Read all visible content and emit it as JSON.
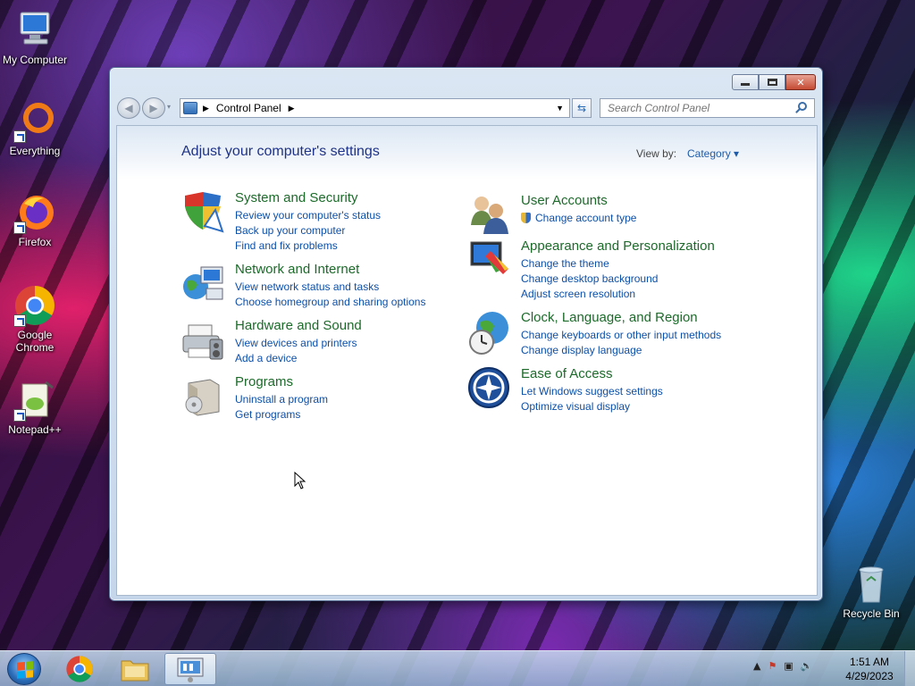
{
  "desktop": {
    "icons": [
      {
        "label": "My Computer"
      },
      {
        "label": "Everything"
      },
      {
        "label": "Firefox"
      },
      {
        "label": "Google Chrome"
      },
      {
        "label": "Notepad++"
      }
    ],
    "recycle_bin": "Recycle Bin"
  },
  "window": {
    "address": {
      "root": "Control Panel"
    },
    "search_placeholder": "Search Control Panel",
    "title": "Adjust your computer's settings",
    "view_by_label": "View by:",
    "view_by_value": "Category",
    "categories_left": [
      {
        "title": "System and Security",
        "icon": "shield-icon",
        "links": [
          "Review your computer's status",
          "Back up your computer",
          "Find and fix problems"
        ]
      },
      {
        "title": "Network and Internet",
        "icon": "network-globe-icon",
        "links": [
          "View network status and tasks",
          "Choose homegroup and sharing options"
        ]
      },
      {
        "title": "Hardware and Sound",
        "icon": "printer-icon",
        "links": [
          "View devices and printers",
          "Add a device"
        ]
      },
      {
        "title": "Programs",
        "icon": "programs-box-icon",
        "links": [
          "Uninstall a program",
          "Get programs"
        ]
      }
    ],
    "categories_right": [
      {
        "title": "User Accounts",
        "icon": "users-icon",
        "links": [
          "Change account type"
        ]
      },
      {
        "title": "Appearance and Personalization",
        "icon": "monitor-paint-icon",
        "links": [
          "Change the theme",
          "Change desktop background",
          "Adjust screen resolution"
        ]
      },
      {
        "title": "Clock, Language, and Region",
        "icon": "globe-clock-icon",
        "links": [
          "Change keyboards or other input methods",
          "Change display language"
        ]
      },
      {
        "title": "Ease of Access",
        "icon": "ease-of-access-icon",
        "links": [
          "Let Windows suggest settings",
          "Optimize visual display"
        ]
      }
    ]
  },
  "taskbar": {
    "time": "1:51 AM",
    "date": "4/29/2023"
  },
  "colors": {
    "link": "#0c4fa8",
    "category_title": "#1c6a2a",
    "page_title": "#1e3287"
  }
}
